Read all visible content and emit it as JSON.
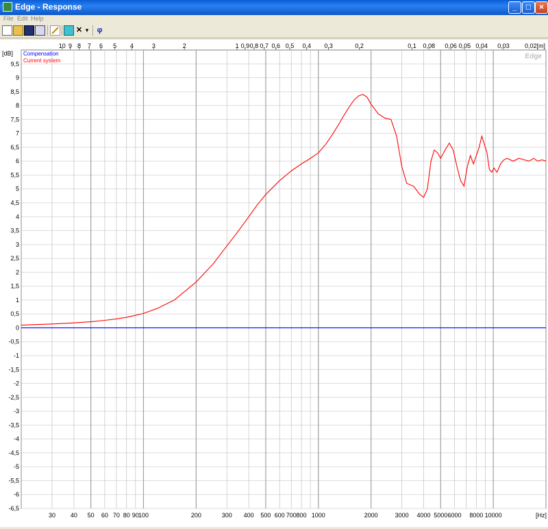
{
  "window": {
    "title": "Edge - Response"
  },
  "menu": {
    "file": "File",
    "edit": "Edit",
    "help": "Help"
  },
  "toolbar": {
    "phase_symbol": "φ",
    "x_symbol": "✕",
    "dropdown_symbol": "▾"
  },
  "colors": {
    "compensation": "#0000ff",
    "current": "#ff0000",
    "grid_major": "#a0a0a0",
    "grid_minor": "#c8c8c8"
  },
  "chart_data": {
    "type": "line",
    "watermark": "Edge",
    "ylabel": "[dB]",
    "xlabel": "[Hz]",
    "top_axis_unit": "0,02[m]",
    "x_scale": "log",
    "xlim": [
      20,
      20000
    ],
    "ylim": [
      -6.5,
      10
    ],
    "legend_placement": "top-left",
    "y_ticks": [
      "9,5",
      "9",
      "8,5",
      "8",
      "7,5",
      "7",
      "6,5",
      "6",
      "5,5",
      "5",
      "4,5",
      "4",
      "3,5",
      "3",
      "2,5",
      "2",
      "1,5",
      "1",
      "0,5",
      "0",
      "-0,5",
      "-1",
      "-1,5",
      "-2",
      "-2,5",
      "-3",
      "-3,5",
      "-4",
      "-4,5",
      "-5",
      "-5,5",
      "-6",
      "-6,5"
    ],
    "x_ticks": [
      {
        "v": 30,
        "t": "30"
      },
      {
        "v": 40,
        "t": "40"
      },
      {
        "v": 50,
        "t": "50"
      },
      {
        "v": 60,
        "t": "60"
      },
      {
        "v": 70,
        "t": "70"
      },
      {
        "v": 80,
        "t": "80"
      },
      {
        "v": 90,
        "t": "90"
      },
      {
        "v": 100,
        "t": "100"
      },
      {
        "v": 200,
        "t": "200"
      },
      {
        "v": 300,
        "t": "300"
      },
      {
        "v": 400,
        "t": "400"
      },
      {
        "v": 500,
        "t": "500"
      },
      {
        "v": 600,
        "t": "600"
      },
      {
        "v": 700,
        "t": "700"
      },
      {
        "v": 800,
        "t": "800"
      },
      {
        "v": 1000,
        "t": "1000"
      },
      {
        "v": 2000,
        "t": "2000"
      },
      {
        "v": 3000,
        "t": "3000"
      },
      {
        "v": 4000,
        "t": "4000"
      },
      {
        "v": 5000,
        "t": "5000"
      },
      {
        "v": 6000,
        "t": "6000"
      },
      {
        "v": 8000,
        "t": "8000"
      },
      {
        "v": 10000,
        "t": "10000"
      }
    ],
    "top_ticks": [
      {
        "m": 10,
        "t": "10"
      },
      {
        "m": 9,
        "t": "9"
      },
      {
        "m": 8,
        "t": "8"
      },
      {
        "m": 7,
        "t": "7"
      },
      {
        "m": 6,
        "t": "6"
      },
      {
        "m": 5,
        "t": "5"
      },
      {
        "m": 4,
        "t": "4"
      },
      {
        "m": 3,
        "t": "3"
      },
      {
        "m": 2,
        "t": "2"
      },
      {
        "m": 1,
        "t": "1"
      },
      {
        "m": 0.9,
        "t": "0,9"
      },
      {
        "m": 0.8,
        "t": "0,8"
      },
      {
        "m": 0.7,
        "t": "0,7"
      },
      {
        "m": 0.6,
        "t": "0,6"
      },
      {
        "m": 0.5,
        "t": "0,5"
      },
      {
        "m": 0.4,
        "t": "0,4"
      },
      {
        "m": 0.3,
        "t": "0,3"
      },
      {
        "m": 0.2,
        "t": "0,2"
      },
      {
        "m": 0.1,
        "t": "0,1"
      },
      {
        "m": 0.08,
        "t": "0,08"
      },
      {
        "m": 0.06,
        "t": "0,06"
      },
      {
        "m": 0.05,
        "t": "0,05"
      },
      {
        "m": 0.04,
        "t": "0,04"
      },
      {
        "m": 0.03,
        "t": "0,03"
      }
    ],
    "series": [
      {
        "name": "Compensation",
        "color": "#0000ff",
        "x": [
          20,
          20000
        ],
        "y": [
          0,
          0
        ]
      },
      {
        "name": "Current system",
        "color": "#ff0000",
        "x": [
          20,
          30,
          40,
          50,
          60,
          70,
          80,
          90,
          100,
          120,
          150,
          200,
          250,
          300,
          350,
          400,
          450,
          500,
          600,
          700,
          800,
          900,
          1000,
          1100,
          1200,
          1300,
          1400,
          1500,
          1600,
          1700,
          1800,
          1900,
          2000,
          2200,
          2400,
          2600,
          2800,
          3000,
          3200,
          3500,
          3800,
          4000,
          4200,
          4400,
          4600,
          4800,
          5000,
          5300,
          5600,
          5900,
          6200,
          6500,
          6800,
          7100,
          7400,
          7700,
          8000,
          8300,
          8600,
          8900,
          9200,
          9500,
          9800,
          10100,
          10500,
          11000,
          11500,
          12000,
          13000,
          14000,
          15000,
          16000,
          17000,
          18000,
          19000,
          20000
        ],
        "y": [
          0.1,
          0.14,
          0.18,
          0.22,
          0.27,
          0.32,
          0.38,
          0.45,
          0.52,
          0.7,
          1.0,
          1.65,
          2.3,
          2.95,
          3.5,
          4.0,
          4.45,
          4.8,
          5.3,
          5.65,
          5.9,
          6.1,
          6.3,
          6.6,
          6.95,
          7.3,
          7.65,
          7.95,
          8.2,
          8.35,
          8.4,
          8.3,
          8.05,
          7.7,
          7.55,
          7.5,
          6.9,
          5.8,
          5.2,
          5.1,
          4.8,
          4.7,
          5.0,
          6.0,
          6.4,
          6.3,
          6.1,
          6.4,
          6.65,
          6.4,
          5.8,
          5.3,
          5.1,
          5.8,
          6.2,
          5.9,
          6.2,
          6.5,
          6.9,
          6.6,
          6.3,
          5.7,
          5.6,
          5.75,
          5.6,
          5.9,
          6.05,
          6.1,
          6.0,
          6.1,
          6.05,
          6.0,
          6.1,
          6.0,
          6.05,
          6.0
        ]
      }
    ]
  }
}
